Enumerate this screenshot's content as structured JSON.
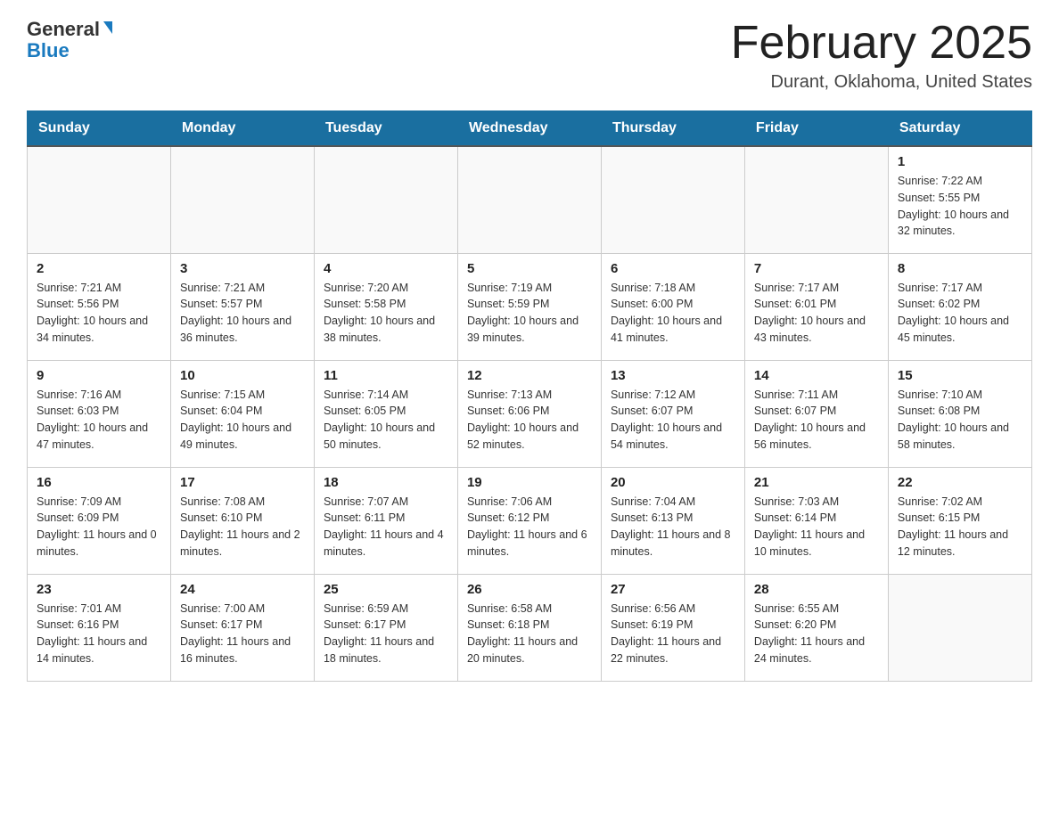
{
  "header": {
    "logo_general": "General",
    "logo_blue": "Blue",
    "month_title": "February 2025",
    "location": "Durant, Oklahoma, United States"
  },
  "days_of_week": [
    "Sunday",
    "Monday",
    "Tuesday",
    "Wednesday",
    "Thursday",
    "Friday",
    "Saturday"
  ],
  "weeks": [
    [
      {
        "day": "",
        "info": ""
      },
      {
        "day": "",
        "info": ""
      },
      {
        "day": "",
        "info": ""
      },
      {
        "day": "",
        "info": ""
      },
      {
        "day": "",
        "info": ""
      },
      {
        "day": "",
        "info": ""
      },
      {
        "day": "1",
        "info": "Sunrise: 7:22 AM\nSunset: 5:55 PM\nDaylight: 10 hours and 32 minutes."
      }
    ],
    [
      {
        "day": "2",
        "info": "Sunrise: 7:21 AM\nSunset: 5:56 PM\nDaylight: 10 hours and 34 minutes."
      },
      {
        "day": "3",
        "info": "Sunrise: 7:21 AM\nSunset: 5:57 PM\nDaylight: 10 hours and 36 minutes."
      },
      {
        "day": "4",
        "info": "Sunrise: 7:20 AM\nSunset: 5:58 PM\nDaylight: 10 hours and 38 minutes."
      },
      {
        "day": "5",
        "info": "Sunrise: 7:19 AM\nSunset: 5:59 PM\nDaylight: 10 hours and 39 minutes."
      },
      {
        "day": "6",
        "info": "Sunrise: 7:18 AM\nSunset: 6:00 PM\nDaylight: 10 hours and 41 minutes."
      },
      {
        "day": "7",
        "info": "Sunrise: 7:17 AM\nSunset: 6:01 PM\nDaylight: 10 hours and 43 minutes."
      },
      {
        "day": "8",
        "info": "Sunrise: 7:17 AM\nSunset: 6:02 PM\nDaylight: 10 hours and 45 minutes."
      }
    ],
    [
      {
        "day": "9",
        "info": "Sunrise: 7:16 AM\nSunset: 6:03 PM\nDaylight: 10 hours and 47 minutes."
      },
      {
        "day": "10",
        "info": "Sunrise: 7:15 AM\nSunset: 6:04 PM\nDaylight: 10 hours and 49 minutes."
      },
      {
        "day": "11",
        "info": "Sunrise: 7:14 AM\nSunset: 6:05 PM\nDaylight: 10 hours and 50 minutes."
      },
      {
        "day": "12",
        "info": "Sunrise: 7:13 AM\nSunset: 6:06 PM\nDaylight: 10 hours and 52 minutes."
      },
      {
        "day": "13",
        "info": "Sunrise: 7:12 AM\nSunset: 6:07 PM\nDaylight: 10 hours and 54 minutes."
      },
      {
        "day": "14",
        "info": "Sunrise: 7:11 AM\nSunset: 6:07 PM\nDaylight: 10 hours and 56 minutes."
      },
      {
        "day": "15",
        "info": "Sunrise: 7:10 AM\nSunset: 6:08 PM\nDaylight: 10 hours and 58 minutes."
      }
    ],
    [
      {
        "day": "16",
        "info": "Sunrise: 7:09 AM\nSunset: 6:09 PM\nDaylight: 11 hours and 0 minutes."
      },
      {
        "day": "17",
        "info": "Sunrise: 7:08 AM\nSunset: 6:10 PM\nDaylight: 11 hours and 2 minutes."
      },
      {
        "day": "18",
        "info": "Sunrise: 7:07 AM\nSunset: 6:11 PM\nDaylight: 11 hours and 4 minutes."
      },
      {
        "day": "19",
        "info": "Sunrise: 7:06 AM\nSunset: 6:12 PM\nDaylight: 11 hours and 6 minutes."
      },
      {
        "day": "20",
        "info": "Sunrise: 7:04 AM\nSunset: 6:13 PM\nDaylight: 11 hours and 8 minutes."
      },
      {
        "day": "21",
        "info": "Sunrise: 7:03 AM\nSunset: 6:14 PM\nDaylight: 11 hours and 10 minutes."
      },
      {
        "day": "22",
        "info": "Sunrise: 7:02 AM\nSunset: 6:15 PM\nDaylight: 11 hours and 12 minutes."
      }
    ],
    [
      {
        "day": "23",
        "info": "Sunrise: 7:01 AM\nSunset: 6:16 PM\nDaylight: 11 hours and 14 minutes."
      },
      {
        "day": "24",
        "info": "Sunrise: 7:00 AM\nSunset: 6:17 PM\nDaylight: 11 hours and 16 minutes."
      },
      {
        "day": "25",
        "info": "Sunrise: 6:59 AM\nSunset: 6:17 PM\nDaylight: 11 hours and 18 minutes."
      },
      {
        "day": "26",
        "info": "Sunrise: 6:58 AM\nSunset: 6:18 PM\nDaylight: 11 hours and 20 minutes."
      },
      {
        "day": "27",
        "info": "Sunrise: 6:56 AM\nSunset: 6:19 PM\nDaylight: 11 hours and 22 minutes."
      },
      {
        "day": "28",
        "info": "Sunrise: 6:55 AM\nSunset: 6:20 PM\nDaylight: 11 hours and 24 minutes."
      },
      {
        "day": "",
        "info": ""
      }
    ]
  ]
}
